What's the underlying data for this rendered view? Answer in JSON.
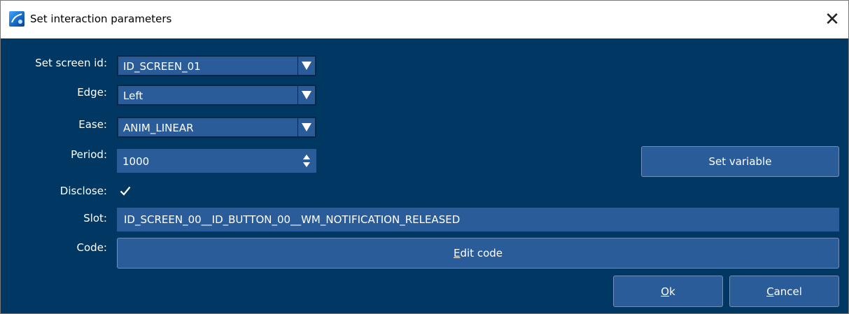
{
  "window": {
    "title": "Set interaction parameters",
    "close_glyph": "✕"
  },
  "fields": {
    "screen_id": {
      "label": "Set screen id:",
      "value": "ID_SCREEN_01"
    },
    "edge": {
      "label": "Edge:",
      "value": "Left"
    },
    "ease": {
      "label": "Ease:",
      "value": "ANIM_LINEAR"
    },
    "period": {
      "label": "Period:",
      "value": "1000"
    },
    "disclose": {
      "label": "Disclose:",
      "checked": true
    },
    "slot": {
      "label": "Slot:",
      "value": "ID_SCREEN_00__ID_BUTTON_00__WM_NOTIFICATION_RELEASED"
    },
    "code": {
      "label": "Code:"
    }
  },
  "buttons": {
    "set_variable": "Set variable",
    "edit_code_mnemonic": "E",
    "edit_code_rest": "dit code",
    "ok_mnemonic": "O",
    "ok_rest": "k",
    "cancel_mnemonic": "C",
    "cancel_rest": "ancel"
  },
  "icons": {
    "app": "app-icon",
    "close": "close-icon",
    "dropdown": "triangle-down-icon",
    "spin_up": "spin-up-icon",
    "spin_down": "spin-down-icon",
    "check": "checkmark-icon"
  },
  "colors": {
    "dialog_bg": "#003863",
    "control_bg": "#2a5c9a",
    "text": "#ffffff"
  }
}
